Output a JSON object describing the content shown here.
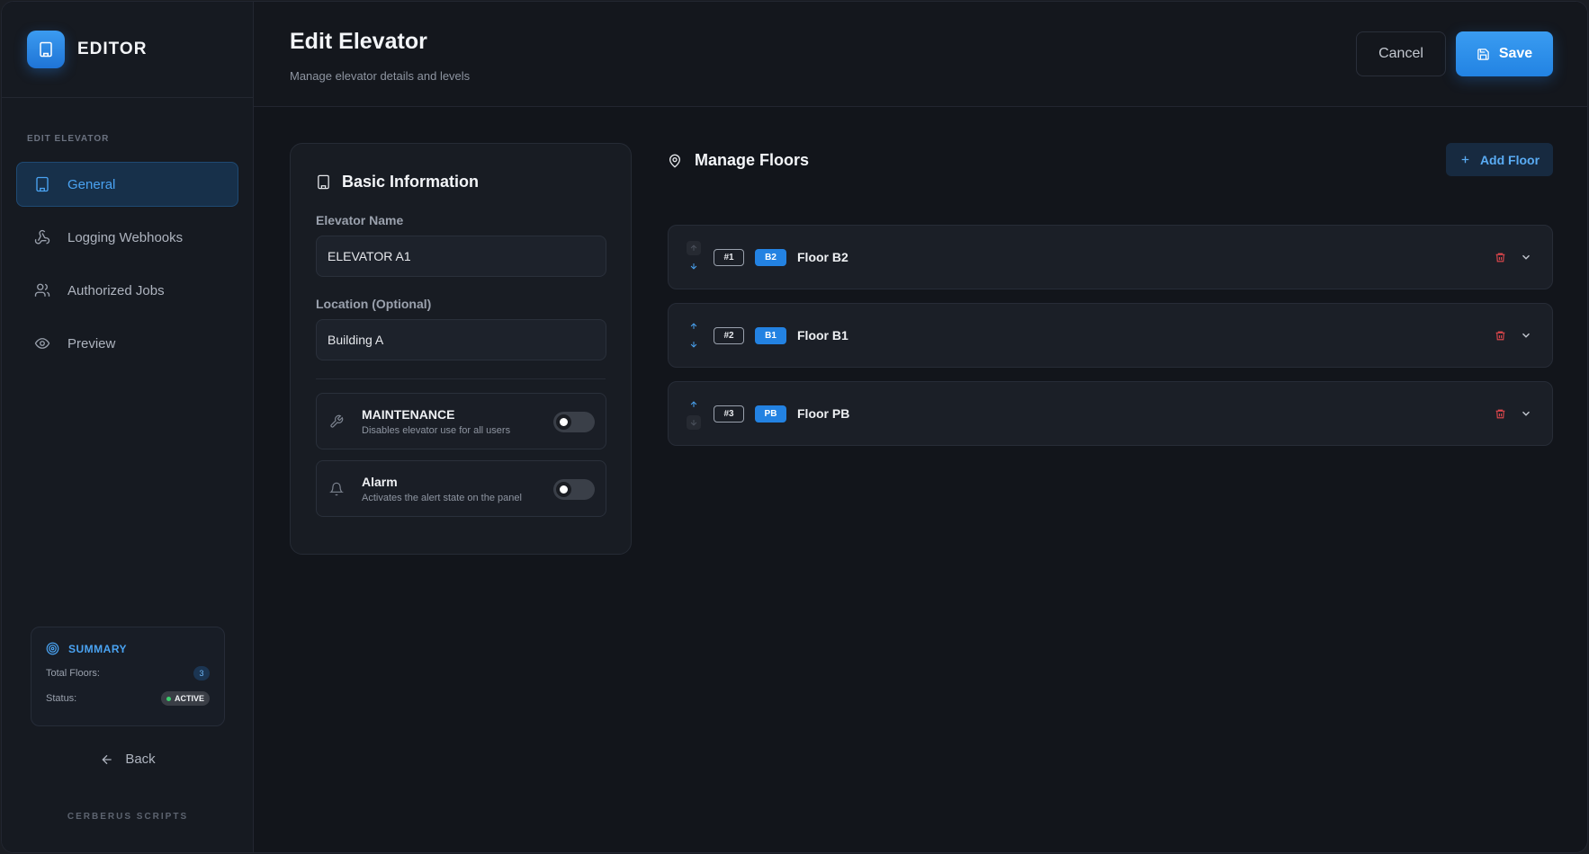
{
  "sidebar": {
    "brand_title": "EDITOR",
    "section_label": "EDIT ELEVATOR",
    "items": [
      {
        "label": "General",
        "icon": "building-icon",
        "active": true
      },
      {
        "label": "Logging Webhooks",
        "icon": "webhook-icon",
        "active": false
      },
      {
        "label": "Authorized Jobs",
        "icon": "users-icon",
        "active": false
      },
      {
        "label": "Preview",
        "icon": "eye-icon",
        "active": false
      }
    ],
    "summary": {
      "title": "SUMMARY",
      "total_floors_label": "Total Floors:",
      "total_floors_value": "3",
      "status_label": "Status:",
      "status_value": "ACTIVE"
    },
    "back_label": "Back",
    "footer": "CERBERUS SCRIPTS"
  },
  "header": {
    "title": "Edit Elevator",
    "subtitle": "Manage elevator details and levels",
    "cancel_label": "Cancel",
    "save_label": "Save"
  },
  "basic_info": {
    "title": "Basic Information",
    "name_label": "Elevator Name",
    "name_value": "ELEVATOR A1",
    "location_label": "Location (Optional)",
    "location_value": "Building A",
    "toggles": [
      {
        "title": "MAINTENANCE",
        "desc": "Disables elevator use for all users",
        "on": false,
        "icon": "wrench-icon"
      },
      {
        "title": "Alarm",
        "desc": "Activates the alert state on the panel",
        "on": false,
        "icon": "bell-icon"
      }
    ]
  },
  "floors": {
    "title": "Manage Floors",
    "add_label": "Add Floor",
    "rows": [
      {
        "order": "#1",
        "code": "B2",
        "name": "Floor B2"
      },
      {
        "order": "#2",
        "code": "B1",
        "name": "Floor B1"
      },
      {
        "order": "#3",
        "code": "PB",
        "name": "Floor PB"
      }
    ]
  },
  "colors": {
    "accent": "#2382e2",
    "background": "#12151b",
    "danger": "#e5484d",
    "success": "#3ccf6e"
  }
}
